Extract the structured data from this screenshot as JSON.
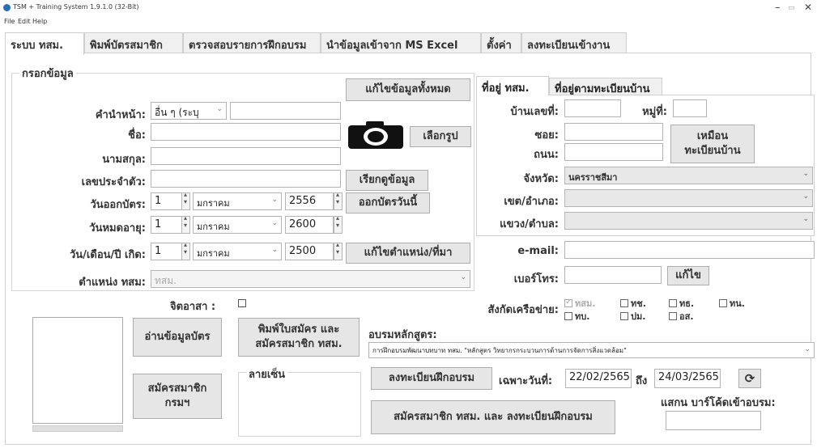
{
  "window": {
    "title": "TSM + Training System 1.9.1.0 (32-Bit)",
    "minimize": "–",
    "maximize": "▭",
    "close": "✕"
  },
  "menu": [
    "File",
    "Edit",
    "Help"
  ],
  "tabs": [
    {
      "label": "ระบบ ทสม."
    },
    {
      "label": "พิมพ์บัตรสมาชิก"
    },
    {
      "label": "ตรวจสอบรายการฝึกอบรม"
    },
    {
      "label": "นำข้อมูลเข้าจาก MS Excel"
    },
    {
      "label": "ตั้งค่า"
    },
    {
      "label": "ลงทะเบียนเข้างาน"
    }
  ],
  "form": {
    "group_title": "กรอกข้อมูล",
    "edit_all": "แก้ไขข้อมูลทั้งหมด",
    "prefix_label": "คำนำหน้า:",
    "prefix_value": "อื่น ๆ (ระบุ",
    "firstname_label": "ชื่อ:",
    "choose_photo": "เลือกรูป",
    "lastname_label": "นามสกุล:",
    "id_label": "เลขประจำตัว:",
    "fetch_data": "เรียกดูข้อมูล",
    "issue_label": "วันออกบัตร:",
    "issue_day": "1",
    "issue_month": "มกราคม",
    "issue_year": "2556",
    "issue_today": "ออกบัตรวันนี้",
    "expire_label": "วันหมดอายุ:",
    "expire_day": "1",
    "expire_month": "มกราคม",
    "expire_year": "2600",
    "birth_label": "วัน/เดือน/ปี เกิด:",
    "birth_day": "1",
    "birth_month": "มกราคม",
    "birth_year": "2500",
    "edit_position": "แก้ไขตำแหน่ง/ที่มา",
    "position_label": "ตำแหน่ง ทสม:",
    "position_value": "ทสม.",
    "volunteer_label": "จิตอาสา :"
  },
  "address": {
    "tab_active": "ที่อยู่ ทสม.",
    "tab_other": "ที่อยู่ตามทะเบียนบ้าน",
    "house_no": "บ้านเลขที่:",
    "moo": "หมู่ที่:",
    "soi": "ซอย:",
    "road": "ถนน:",
    "same_as": "เหมือน\nทะเบียนบ้าน",
    "province": "จังหวัด:",
    "province_value": "นครราชสีมา",
    "district": "เขต/อำเภอ:",
    "subdistrict": "แขวง/ตำบล:"
  },
  "contact": {
    "email_label": "e-mail:",
    "phone_label": "เบอร์โทร:",
    "edit": "แก้ไข"
  },
  "network": {
    "label": "สังกัดเครือข่าย:",
    "items": [
      {
        "text": "ทสม.",
        "disabled": true,
        "checked": true
      },
      {
        "text": "ทช.",
        "disabled": false,
        "checked": false
      },
      {
        "text": "ทธ.",
        "disabled": false,
        "checked": false
      },
      {
        "text": "ทน.",
        "disabled": false,
        "checked": false
      },
      {
        "text": "ทบ.",
        "disabled": false,
        "checked": false
      },
      {
        "text": "ปม.",
        "disabled": false,
        "checked": false
      },
      {
        "text": "อส.",
        "disabled": false,
        "checked": false
      }
    ]
  },
  "bottom": {
    "read_card": "อ่านข้อมูลบัตร",
    "print_apply": "พิมพ์ใบสมัคร และ\nสมัครสมาชิก ทสม.",
    "apply_dept": "สมัครสมาชิก\nกรมฯ",
    "signature": "ลายเซ็น",
    "course_label": "อบรมหลักสูตร:",
    "course_value": "การฝึกอบรมพัฒนาบทบาท ทสม. \"หลักสูตร วิทยากรกระบวนการด้านการจัดการสิ่งแวดล้อม\"",
    "register_training": "ลงทะเบียนฝึกอบรม",
    "specific_date": "เฉพาะวันที่:",
    "date_from": "22/02/2565",
    "date_to_label": "ถึง",
    "date_to": "24/03/2565",
    "refresh_icon": "⟳",
    "scan_label": "แสกน บาร์โค้ดเข้าอบรม:",
    "apply_and_register": "สมัครสมาชิก ทสม. และ ลงทะเบียนฝึกอบรม"
  }
}
